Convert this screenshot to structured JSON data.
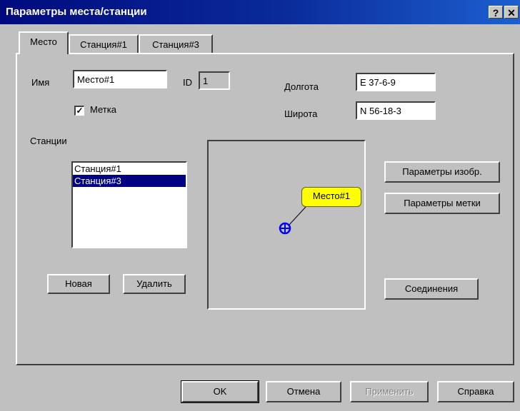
{
  "window": {
    "title": "Параметры места/станции",
    "help_label": "?",
    "close_label": "✕"
  },
  "tabs": [
    {
      "label": "Место",
      "active": true
    },
    {
      "label": "Станция#1",
      "active": false
    },
    {
      "label": "Станция#3",
      "active": false
    }
  ],
  "place": {
    "name_label": "Имя",
    "name_value": "Место#1",
    "id_label": "ID",
    "id_value": "1",
    "longitude_label": "Долгота",
    "longitude_value": "E 37-6-9",
    "latitude_label": "Широта",
    "latitude_value": "N 56-18-3",
    "marker_checkbox_label": "Метка",
    "marker_checked": true
  },
  "stations": {
    "label": "Станции",
    "items": [
      {
        "label": "Станция#1",
        "selected": false
      },
      {
        "label": "Станция#3",
        "selected": true
      }
    ],
    "new_button": "Новая",
    "delete_button": "Удалить"
  },
  "preview": {
    "marker_label": "Место#1",
    "marker_icon": "crosshair-circle-icon",
    "marker_color": "#0000ff",
    "label_color": "#ffff00"
  },
  "side_buttons": {
    "image_params": "Параметры изобр.",
    "marker_params": "Параметры метки",
    "connections": "Соединения"
  },
  "footer": {
    "ok": "OK",
    "cancel": "Отмена",
    "apply": "Применить",
    "help": "Справка"
  }
}
